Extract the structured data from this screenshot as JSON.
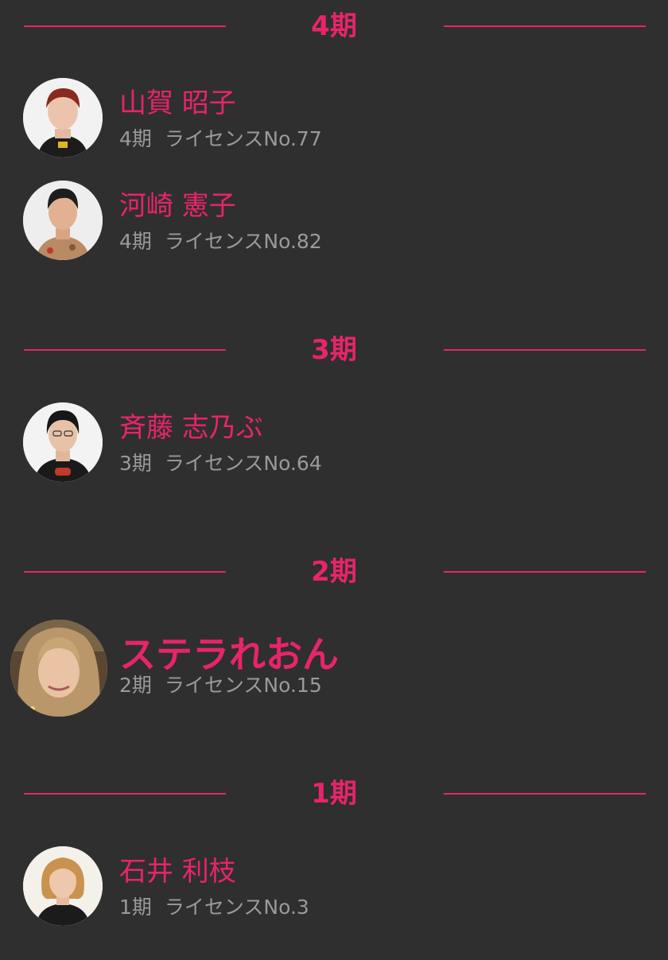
{
  "sections": [
    {
      "title": "4期",
      "members": [
        {
          "name": "山賀 昭子",
          "period": "4期",
          "license": "ライセンスNo.77"
        },
        {
          "name": "河崎 憲子",
          "period": "4期",
          "license": "ライセンスNo.82"
        }
      ]
    },
    {
      "title": "3期",
      "members": [
        {
          "name": "斉藤 志乃ぶ",
          "period": "3期",
          "license": "ライセンスNo.64"
        }
      ]
    },
    {
      "title": "2期",
      "members": [
        {
          "name": "ステラれおん",
          "period": "2期",
          "license": "ライセンスNo.15"
        }
      ]
    },
    {
      "title": "1期",
      "members": [
        {
          "name": "石井 利枝",
          "period": "1期",
          "license": "ライセンスNo.3"
        }
      ]
    }
  ],
  "colors": {
    "background": "#2f2f2f",
    "accent": "#e8246b",
    "meta_text": "#9a9a9a"
  }
}
